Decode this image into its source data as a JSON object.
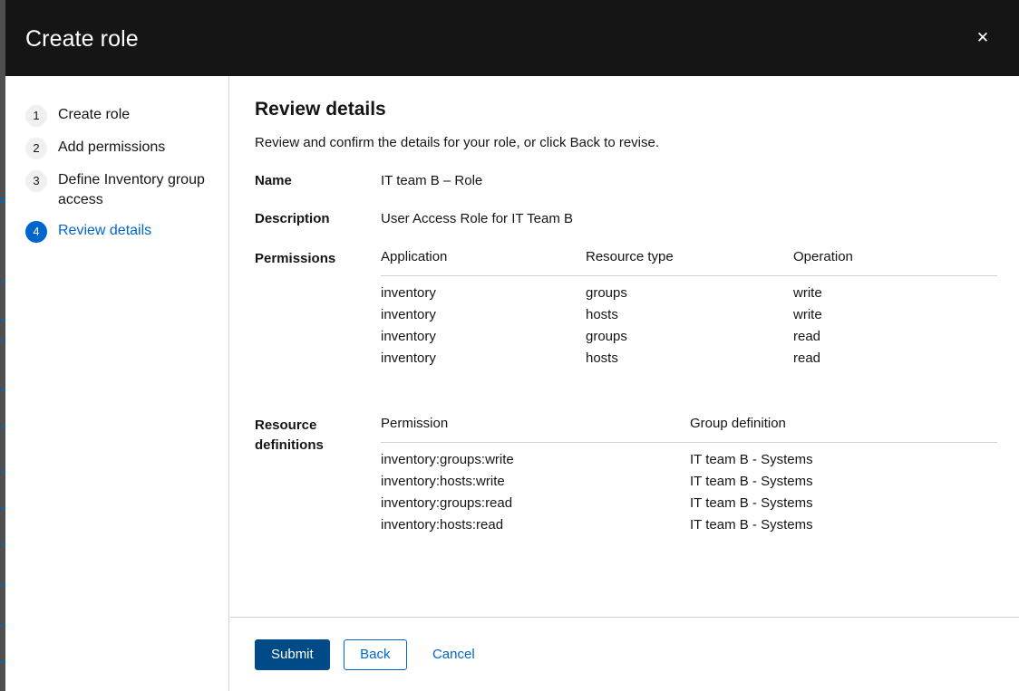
{
  "background": {
    "ghost_marks": [
      218,
      222,
      310,
      352,
      375,
      430,
      470,
      520,
      560,
      600,
      645,
      690,
      730
    ]
  },
  "header": {
    "title": "Create role",
    "close_icon": "close-icon",
    "close_glyph": "✕",
    "background_color": "#151515"
  },
  "nav": {
    "items": [
      {
        "num": "1",
        "label": "Create role",
        "active": false
      },
      {
        "num": "2",
        "label": "Add permissions",
        "active": false
      },
      {
        "num": "3",
        "label": "Define Inventory group access",
        "active": false
      },
      {
        "num": "4",
        "label": "Review details",
        "active": true
      }
    ],
    "active_color": "#0066cc"
  },
  "main": {
    "title": "Review details",
    "subtitle": "Review and confirm the details for your role, or click Back to revise.",
    "details": [
      {
        "label": "Name",
        "value": "IT team B – Role"
      },
      {
        "label": "Description",
        "value": "User Access Role for IT Team B"
      }
    ],
    "permissions": {
      "label": "Permissions",
      "columns": [
        "Application",
        "Resource type",
        "Operation"
      ],
      "rows": [
        [
          "inventory",
          "groups",
          "write"
        ],
        [
          "inventory",
          "hosts",
          "write"
        ],
        [
          "inventory",
          "groups",
          "read"
        ],
        [
          "inventory",
          "hosts",
          "read"
        ]
      ]
    },
    "resource_definitions": {
      "label": "Resource definitions",
      "columns": [
        "Permission",
        "Group definition"
      ],
      "rows": [
        [
          "inventory:groups:write",
          "IT team B - Systems"
        ],
        [
          "inventory:hosts:write",
          "IT team B - Systems"
        ],
        [
          "inventory:groups:read",
          "IT team B - Systems"
        ],
        [
          "inventory:hosts:read",
          "IT team B - Systems"
        ]
      ]
    }
  },
  "footer": {
    "submit_label": "Submit",
    "back_label": "Back",
    "cancel_label": "Cancel",
    "primary_color": "#004b87",
    "link_color": "#0066cc"
  }
}
